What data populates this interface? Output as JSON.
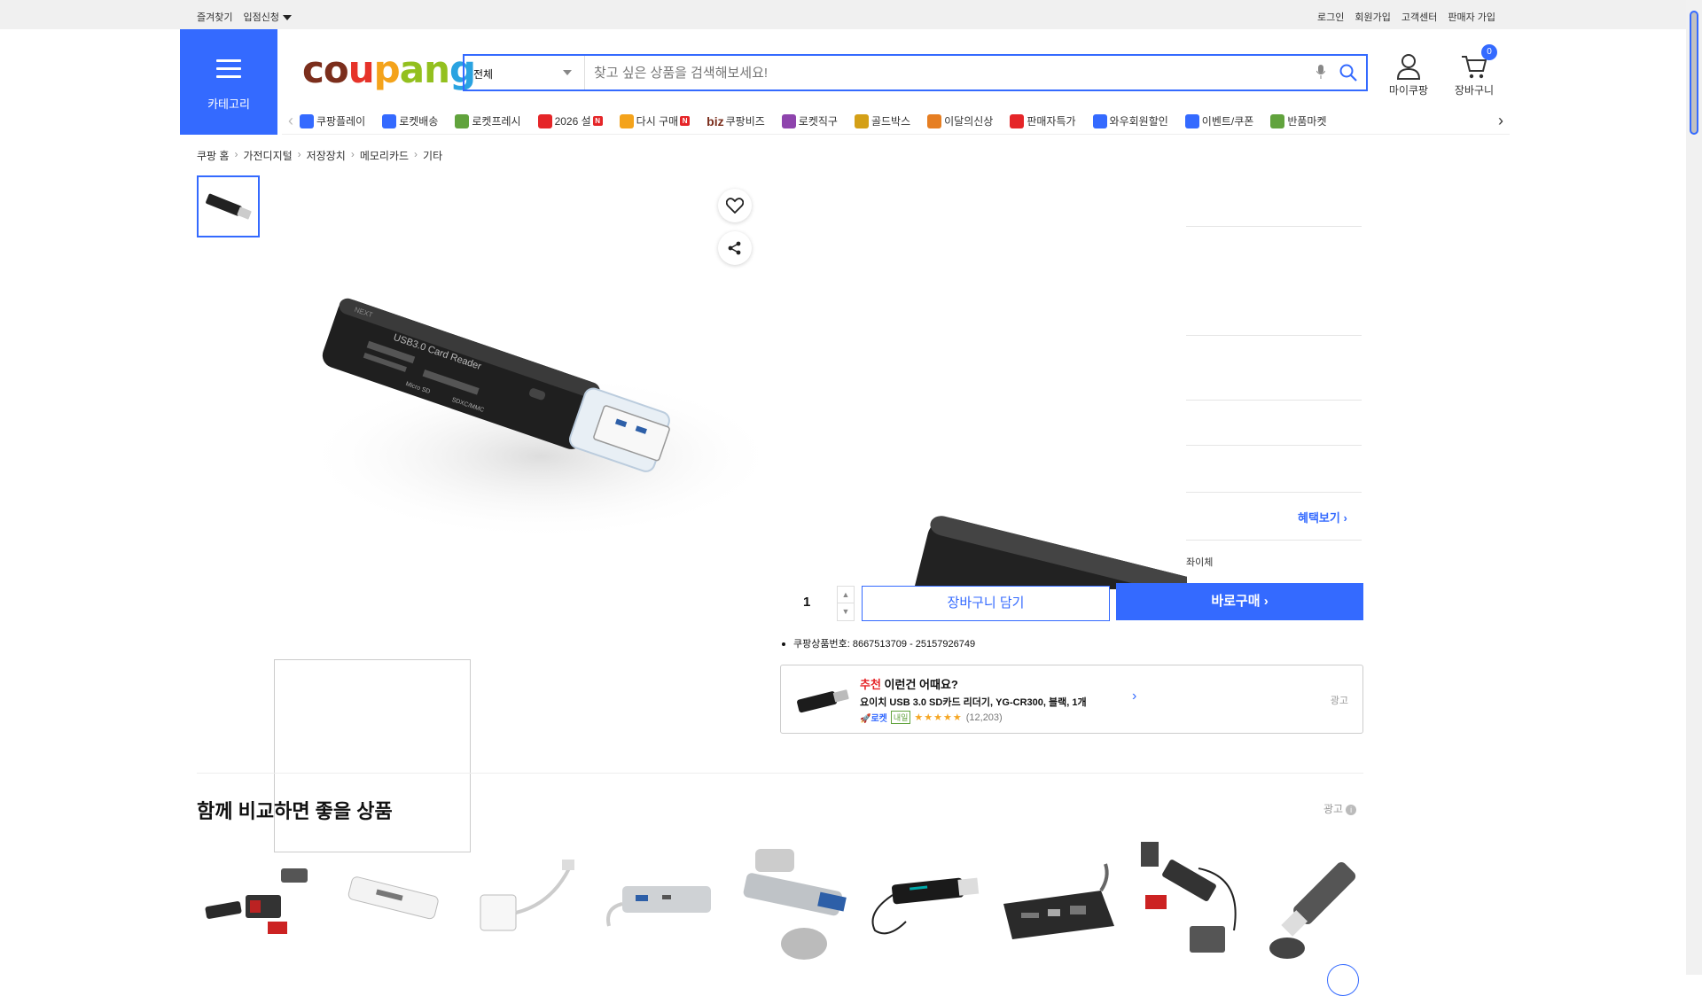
{
  "topbar": {
    "left": [
      "즐겨찾기",
      "입점신청"
    ],
    "right": [
      "로그인",
      "회원가입",
      "고객센터",
      "판매자 가입"
    ]
  },
  "category_label": "카테고리",
  "logo": "coupang",
  "search": {
    "scope": "전체",
    "placeholder": "찾고 싶은 상품을 검색해보세요!"
  },
  "mycoupang_label": "마이쿠팡",
  "cart": {
    "label": "장바구니",
    "count": "0"
  },
  "nav_items": [
    {
      "label": "쿠팡플레이",
      "icon": "play-icon",
      "color": "#346aff"
    },
    {
      "label": "로켓배송",
      "icon": "rocket-icon",
      "color": "#346aff"
    },
    {
      "label": "로켓프레시",
      "icon": "rocket-fresh-icon",
      "color": "#61a33d"
    },
    {
      "label": "2026 설",
      "icon": "gift-icon",
      "color": "#e52528",
      "new": "N"
    },
    {
      "label": "다시 구매",
      "icon": "rebuy-icon",
      "color": "#f4a31b",
      "new": "N"
    },
    {
      "label": "쿠팡비즈",
      "icon": "biz-icon",
      "color": "#7b2e1c",
      "prefix": "biz"
    },
    {
      "label": "로켓직구",
      "icon": "global-icon",
      "color": "#8e44ad"
    },
    {
      "label": "골드박스",
      "icon": "goldbox-icon",
      "color": "#d4a017"
    },
    {
      "label": "이달의신상",
      "icon": "new-arrival-icon",
      "color": "#e67e22"
    },
    {
      "label": "판매자특가",
      "icon": "seller-deal-icon",
      "color": "#e52528"
    },
    {
      "label": "와우회원할인",
      "icon": "wow-icon",
      "color": "#346aff"
    },
    {
      "label": "이벤트/쿠폰",
      "icon": "coupon-icon",
      "color": "#346aff"
    },
    {
      "label": "반품마켓",
      "icon": "return-market-icon",
      "color": "#61a33d"
    }
  ],
  "breadcrumbs": [
    "쿠팡 홈",
    "가전디지털",
    "저장장치",
    "메모리카드",
    "기타"
  ],
  "product": {
    "printed_text": "USB3.0 Card Reader",
    "slots": [
      "Micro SD",
      "SDXC/MMC"
    ],
    "brand": "NEXT"
  },
  "benefit_link": "혜택보기",
  "payment_text": "좌이체",
  "quantity": "1",
  "add_to_cart": "장바구니 담기",
  "buy_now": "바로구매",
  "product_id": "쿠팡상품번호: 8667513709 - 25157926749",
  "recommendation": {
    "headline_red": "추천",
    "headline": "이런건 어때요?",
    "title": "요이치 USB 3.0 SD카드 리더기, YG-CR300, 블랙, 1개",
    "badge_rocket": "로켓",
    "badge_tomorrow": "내일",
    "stars": "★★★★★",
    "reviews": "(12,203)",
    "ad": "광고"
  },
  "compare": {
    "title": "함께 비교하면 좋을 상품",
    "ad": "광고",
    "info": "i"
  }
}
